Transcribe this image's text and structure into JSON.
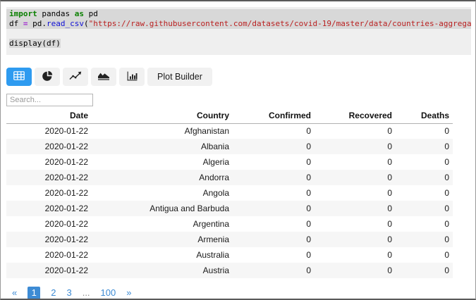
{
  "colors": {
    "accent_blue": "#2e9bf0",
    "pagination_blue": "#3d8bd4",
    "selection_gray": "#d8d8d8",
    "keyword_green": "#0a8000",
    "operator_purple": "#a22fd0",
    "function_blue": "#1111d6",
    "string_red": "#ba2121",
    "row_stripe": "#f6f6f6"
  },
  "code": {
    "lines": [
      {
        "selected": "full",
        "tokens": [
          {
            "text": "import",
            "style": "kw"
          },
          {
            "text": " pandas ",
            "style": "plain"
          },
          {
            "text": "as",
            "style": "kw"
          },
          {
            "text": " pd",
            "style": "plain"
          }
        ]
      },
      {
        "selected": "full",
        "tokens": [
          {
            "text": "df ",
            "style": "plain"
          },
          {
            "text": "=",
            "style": "op"
          },
          {
            "text": " pd.",
            "style": "plain"
          },
          {
            "text": "read_csv",
            "style": "fn"
          },
          {
            "text": "(",
            "style": "plain"
          },
          {
            "text": "\"https://raw.githubusercontent.com/datasets/covid-19/master/data/countries-aggrega",
            "style": "str"
          }
        ]
      },
      {
        "selected": "none",
        "tokens": []
      },
      {
        "selected": "text",
        "tokens": [
          {
            "text": "display(df)",
            "style": "plain"
          }
        ]
      }
    ]
  },
  "toolbar": {
    "buttons": [
      {
        "id": "table-view",
        "icon": "table-icon",
        "active": true
      },
      {
        "id": "pie-chart-view",
        "icon": "pie-chart-icon",
        "active": false
      },
      {
        "id": "line-chart-view",
        "icon": "line-chart-icon",
        "active": false
      },
      {
        "id": "area-chart-view",
        "icon": "area-chart-icon",
        "active": false
      },
      {
        "id": "bar-chart-view",
        "icon": "bar-chart-icon",
        "active": false
      }
    ],
    "plot_builder_label": "Plot Builder"
  },
  "search": {
    "placeholder": "Search..."
  },
  "table": {
    "columns": [
      "Date",
      "Country",
      "Confirmed",
      "Recovered",
      "Deaths"
    ],
    "rows": [
      [
        "2020-01-22",
        "Afghanistan",
        "0",
        "0",
        "0"
      ],
      [
        "2020-01-22",
        "Albania",
        "0",
        "0",
        "0"
      ],
      [
        "2020-01-22",
        "Algeria",
        "0",
        "0",
        "0"
      ],
      [
        "2020-01-22",
        "Andorra",
        "0",
        "0",
        "0"
      ],
      [
        "2020-01-22",
        "Angola",
        "0",
        "0",
        "0"
      ],
      [
        "2020-01-22",
        "Antigua and Barbuda",
        "0",
        "0",
        "0"
      ],
      [
        "2020-01-22",
        "Argentina",
        "0",
        "0",
        "0"
      ],
      [
        "2020-01-22",
        "Armenia",
        "0",
        "0",
        "0"
      ],
      [
        "2020-01-22",
        "Australia",
        "0",
        "0",
        "0"
      ],
      [
        "2020-01-22",
        "Austria",
        "0",
        "0",
        "0"
      ]
    ]
  },
  "pagination": {
    "items": [
      {
        "label": "«",
        "type": "nav-prev"
      },
      {
        "label": "1",
        "type": "page",
        "active": true
      },
      {
        "label": "2",
        "type": "page"
      },
      {
        "label": "3",
        "type": "page"
      },
      {
        "label": "...",
        "type": "ellipsis"
      },
      {
        "label": "100",
        "type": "page"
      },
      {
        "label": "»",
        "type": "nav-next"
      }
    ]
  }
}
